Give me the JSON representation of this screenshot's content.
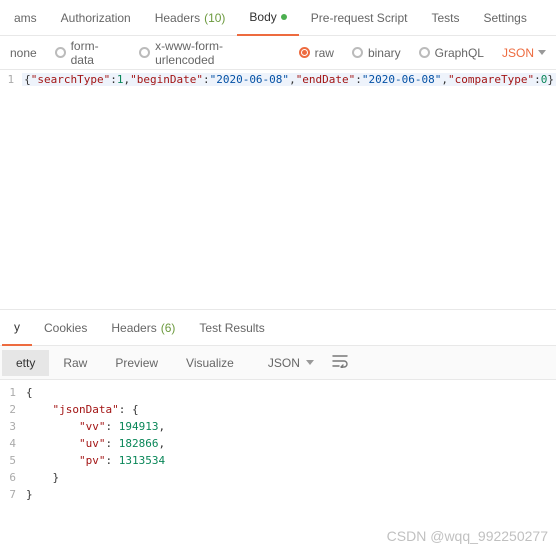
{
  "topTabs": {
    "params": "ams",
    "authorization": "Authorization",
    "headers": "Headers",
    "headersCount": "(10)",
    "body": "Body",
    "preRequest": "Pre-request Script",
    "tests": "Tests",
    "settings": "Settings"
  },
  "bodyTypes": {
    "none": "none",
    "formData": "form-data",
    "xwww": "x-www-form-urlencoded",
    "raw": "raw",
    "binary": "binary",
    "graphql": "GraphQL",
    "jsonLabel": "JSON"
  },
  "requestBody": {
    "lineNo": "1",
    "open": "{",
    "k1": "\"searchType\"",
    "v1": "1",
    "k2": "\"beginDate\"",
    "v2": "\"2020-06-08\"",
    "k3": "\"endDate\"",
    "v3": "\"2020-06-08\"",
    "k4": "\"compareType\"",
    "v4": "0",
    "close": "}"
  },
  "respTabs": {
    "body": "y",
    "cookies": "Cookies",
    "headers": "Headers",
    "headersCount": "(6)",
    "testResults": "Test Results"
  },
  "toolbar": {
    "pretty": "etty",
    "raw": "Raw",
    "preview": "Preview",
    "visualize": "Visualize",
    "json": "JSON"
  },
  "response": {
    "lines": [
      "1",
      "2",
      "3",
      "4",
      "5",
      "6",
      "7"
    ],
    "l1": "{",
    "l2_indent": "    ",
    "l2_key": "\"jsonData\"",
    "l2_rest": ": {",
    "l3_indent": "        ",
    "l3_key": "\"vv\"",
    "l3_sep": ": ",
    "l3_val": "194913",
    "l3_end": ",",
    "l4_key": "\"uv\"",
    "l4_val": "182866",
    "l4_end": ",",
    "l5_key": "\"pv\"",
    "l5_val": "1313534",
    "l6": "    }",
    "l7": "}"
  },
  "watermark": "CSDN @wqq_992250277"
}
